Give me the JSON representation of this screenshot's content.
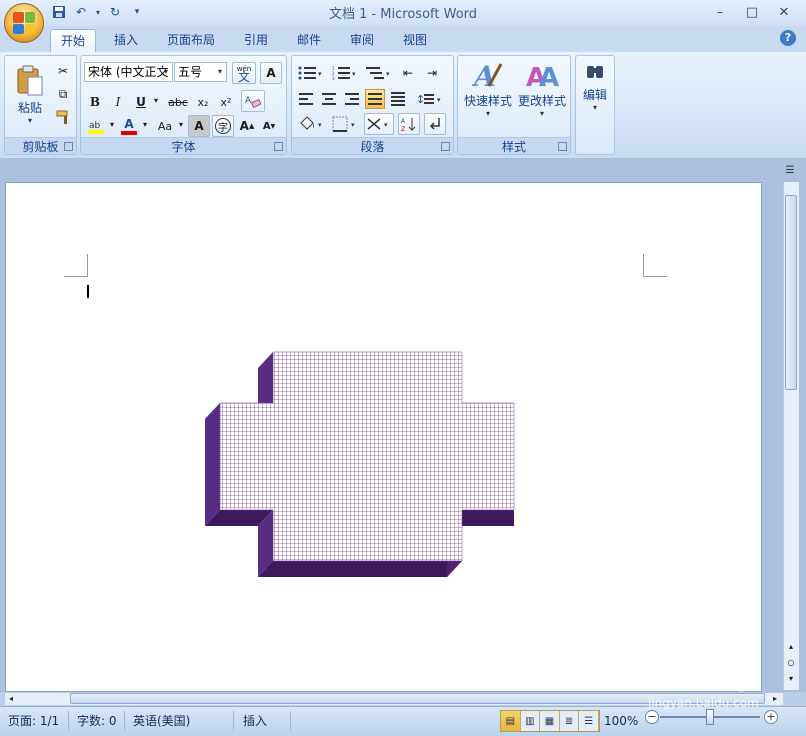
{
  "window": {
    "title": "文档 1 - Microsoft Word",
    "minimize": "–",
    "maximize": "□",
    "close": "✕"
  },
  "tabs": [
    "开始",
    "插入",
    "页面布局",
    "引用",
    "邮件",
    "审阅",
    "视图"
  ],
  "active_tab": "开始",
  "ribbon": {
    "clipboard": {
      "label": "剪贴板",
      "paste": "粘贴"
    },
    "font": {
      "label": "字体",
      "font_name": "宋体 (中文正文",
      "font_size": "五号",
      "pinyin": "wén",
      "bold": "B",
      "italic": "I",
      "underline": "U",
      "strikethrough": "abc",
      "subscript": "x₂",
      "superscript": "x²",
      "font_color": "A",
      "change_case": "Aa",
      "char_shading": "A",
      "enclose": "字",
      "grow": "A",
      "shrink": "A",
      "border_char": "A"
    },
    "paragraph": {
      "label": "段落"
    },
    "styles": {
      "label": "样式",
      "quick_styles": "快速样式",
      "change_styles": "更改样式"
    },
    "editing": {
      "label": "编辑"
    }
  },
  "document": {
    "shape_fill_color": "#5c2d82",
    "shape_top_color": "#8a5bb0",
    "shape_side_color": "#4e2470",
    "shape_grid_color": "#ffffff"
  },
  "status": {
    "page": "页面: 1/1",
    "words": "字数: 0",
    "language": "英语(美国)",
    "mode": "插入",
    "zoom": "100%"
  },
  "watermark": {
    "brand": "Baidu经验",
    "url": "jingyan.baidu.com"
  }
}
